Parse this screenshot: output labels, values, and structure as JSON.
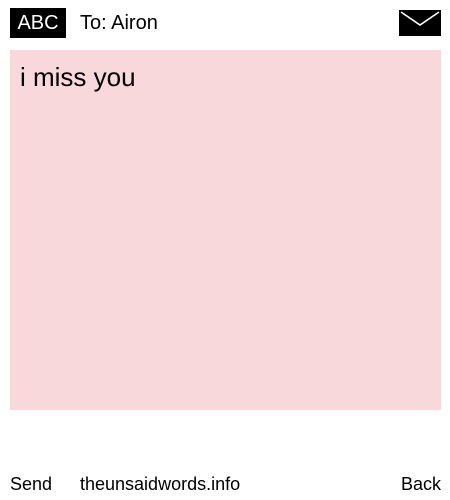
{
  "header": {
    "input_mode": "ABC",
    "recipient": "To: Airon",
    "mail_icon": "envelope-icon"
  },
  "message": {
    "text": "i miss you",
    "background_color": "#f9d8db"
  },
  "footer": {
    "send_label": "Send",
    "site_label": "theunsaidwords.info",
    "back_label": "Back"
  }
}
